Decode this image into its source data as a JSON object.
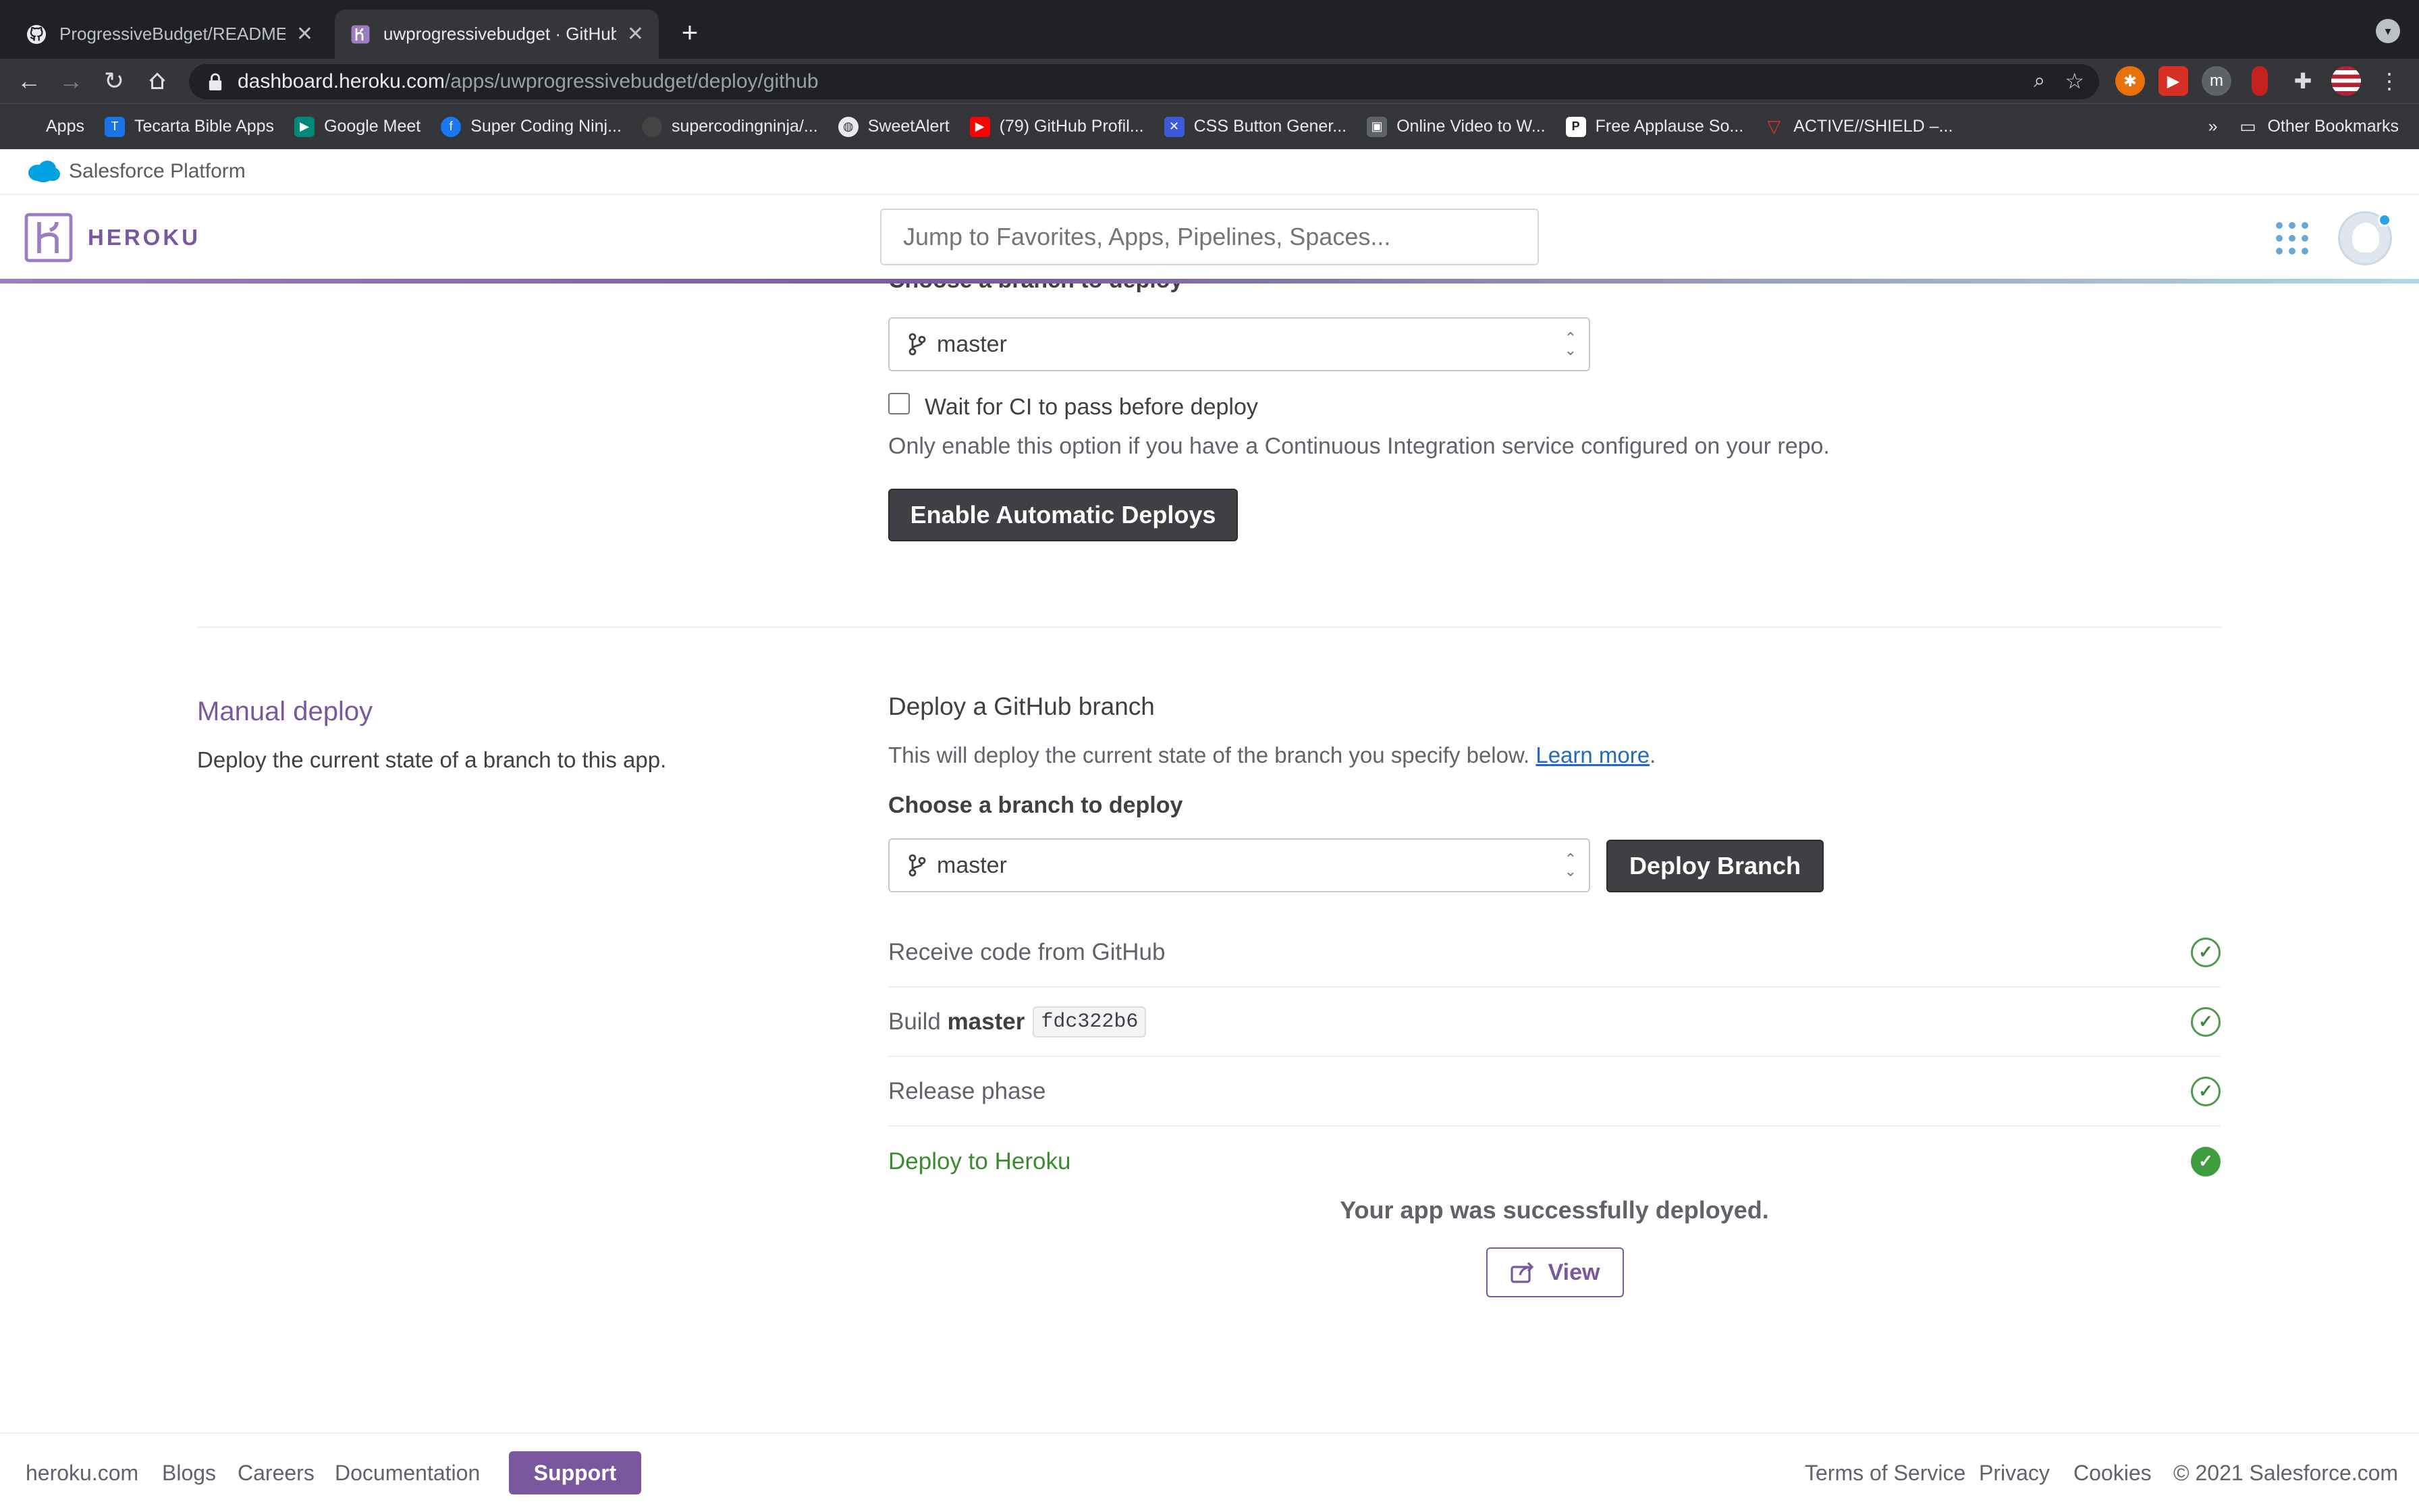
{
  "browser": {
    "tabs": [
      {
        "title": "ProgressiveBudget/README.md",
        "close": "✕"
      },
      {
        "title": "uwprogressivebudget · GitHub",
        "close": "✕"
      }
    ],
    "new_tab": "+",
    "url_host": "dashboard.heroku.com",
    "url_path": "/apps/uwprogressivebudget/deploy/github",
    "bookmarks": [
      {
        "label": "Apps",
        "color": "#e94235"
      },
      {
        "label": "Tecarta Bible Apps",
        "color": "#1a73e8"
      },
      {
        "label": "Google Meet",
        "color": "#00897b"
      },
      {
        "label": "Super Coding Ninj...",
        "color": "#1877f2"
      },
      {
        "label": "supercodingninja/...",
        "color": "#444444"
      },
      {
        "label": "SweetAlert",
        "color": "#5f6368"
      },
      {
        "label": "(79) GitHub Profil...",
        "color": "#ff0000"
      },
      {
        "label": "CSS Button Gener...",
        "color": "#3b5bdb"
      },
      {
        "label": "Online Video to W...",
        "color": "#5f6368"
      },
      {
        "label": "Free Applause So...",
        "color": "#ffffff"
      },
      {
        "label": "ACTIVE//SHIELD –...",
        "color": "#d93025"
      }
    ],
    "bookmarks_more": "»",
    "other_bookmarks": "Other Bookmarks"
  },
  "salesforce": {
    "label": "Salesforce Platform"
  },
  "heroku": {
    "logo_text": "HEROKU",
    "search_placeholder": "Jump to Favorites, Apps, Pipelines, Spaces..."
  },
  "auto_deploy": {
    "choose_label": "Choose a branch to deploy",
    "branch": "master",
    "ci_label": "Wait for CI to pass before deploy",
    "ci_help": "Only enable this option if you have a Continuous Integration service configured on your repo.",
    "enable_button": "Enable Automatic Deploys"
  },
  "manual_deploy": {
    "title": "Manual deploy",
    "description": "Deploy the current state of a branch to this app.",
    "heading": "Deploy a GitHub branch",
    "help": "This will deploy the current state of the branch you specify below.",
    "learn_more": "Learn more",
    "choose_label": "Choose a branch to deploy",
    "branch": "master",
    "deploy_button": "Deploy Branch",
    "steps": [
      {
        "label": "Receive code from GitHub"
      },
      {
        "label": "Build",
        "branch": "master",
        "commit": "fdc322b6"
      },
      {
        "label": "Release phase"
      },
      {
        "label": "Deploy to Heroku"
      }
    ],
    "success": "Your app was successfully deployed.",
    "view_button": "View"
  },
  "footer": {
    "left": [
      "heroku.com",
      "Blogs",
      "Careers",
      "Documentation"
    ],
    "support": "Support",
    "right": [
      "Terms of Service",
      "Privacy",
      "Cookies"
    ],
    "copyright": "© 2021 Salesforce.com"
  },
  "colors": {
    "heroku_purple": "#79589f",
    "success_green": "#3f9d3f",
    "dark_button": "#3f3f44"
  }
}
